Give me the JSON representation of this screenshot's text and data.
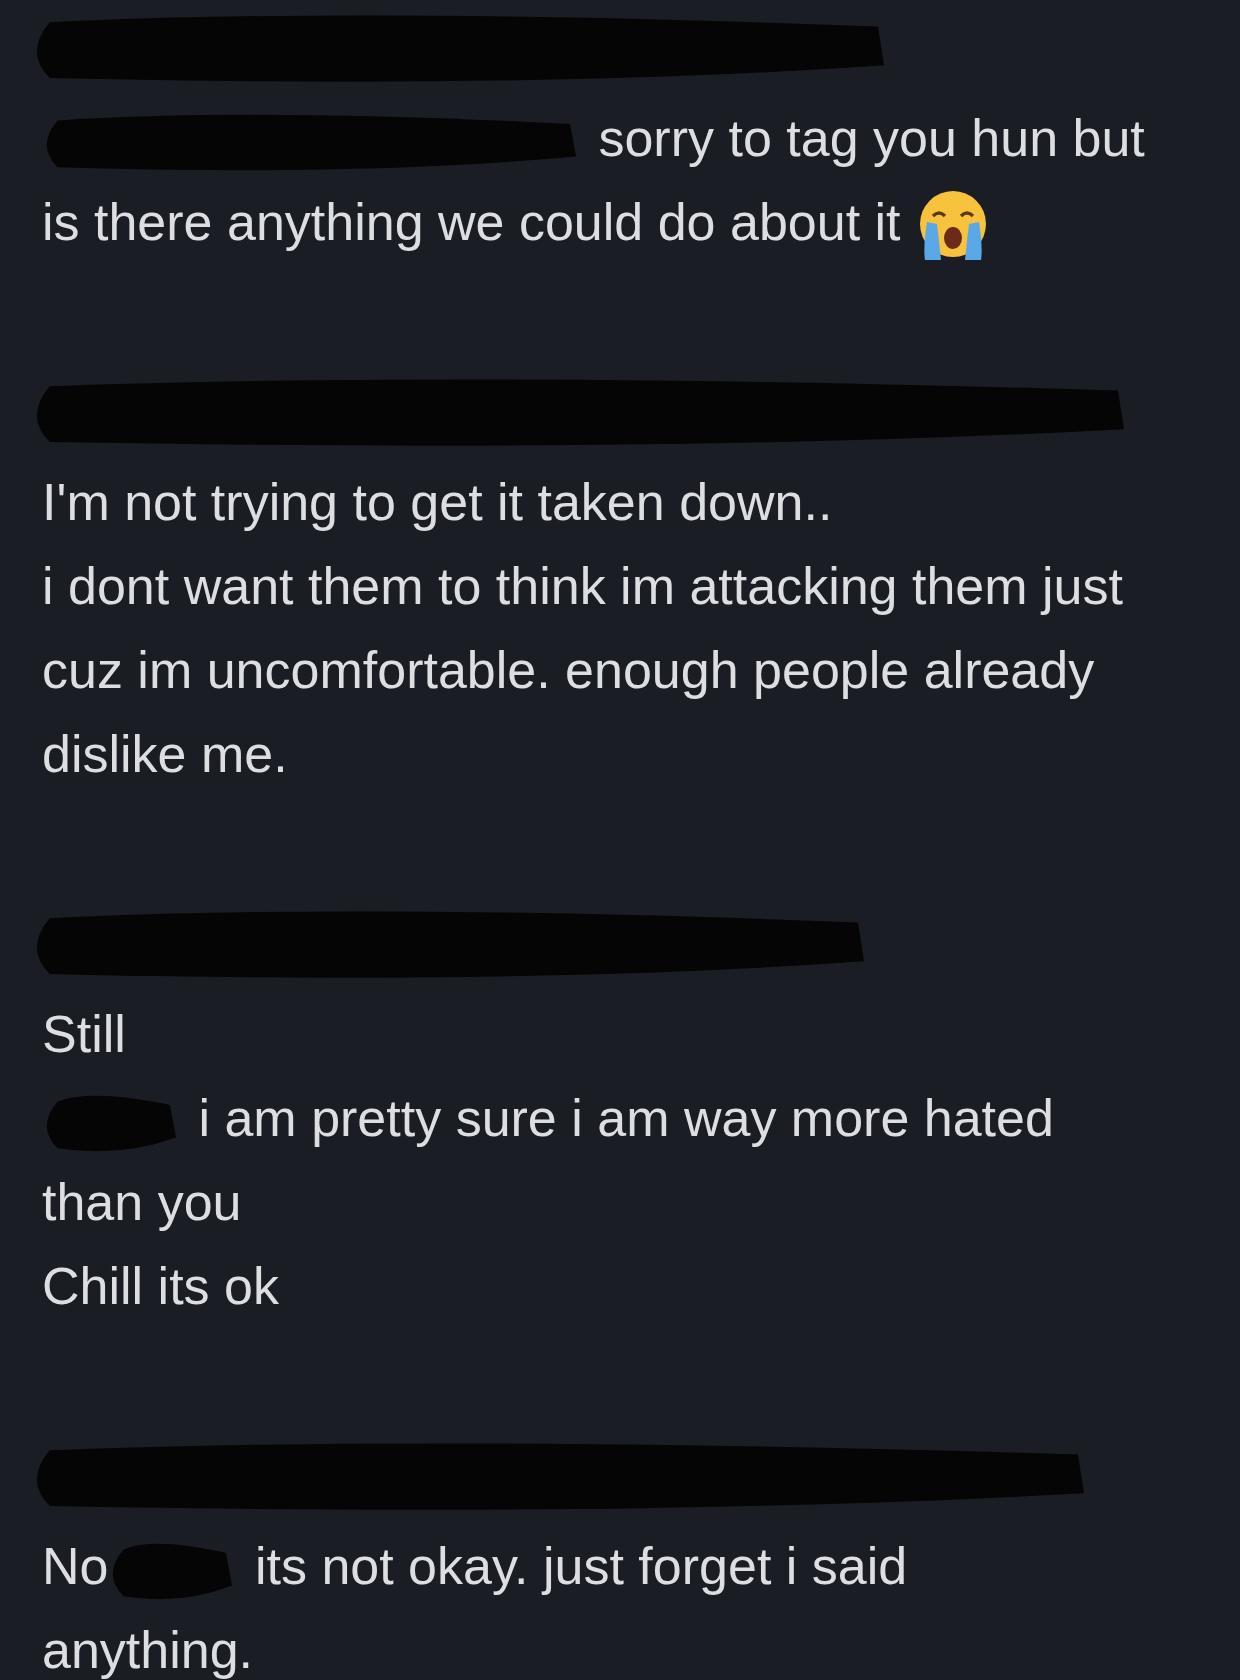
{
  "messages": [
    {
      "header_redacted": true,
      "lines": [
        {
          "segments": [
            {
              "kind": "redaction"
            },
            {
              "kind": "text",
              "text": "sorry to tag you hun but"
            }
          ]
        },
        {
          "segments": [
            {
              "kind": "text",
              "text": "is there anything we could do about it"
            },
            {
              "kind": "emoji"
            }
          ]
        }
      ]
    },
    {
      "header_redacted": true,
      "lines": [
        {
          "segments": [
            {
              "kind": "text",
              "text": "I'm not trying to get it taken down.."
            }
          ]
        },
        {
          "segments": [
            {
              "kind": "text",
              "text": "i dont want them to think im attacking them just cuz im uncomfortable. enough people already dislike me."
            }
          ]
        }
      ]
    },
    {
      "header_redacted": true,
      "lines": [
        {
          "segments": [
            {
              "kind": "text",
              "text": "Still"
            }
          ]
        },
        {
          "segments": [
            {
              "kind": "redaction"
            },
            {
              "kind": "text",
              "text": "i am pretty sure i am way more hated"
            }
          ]
        },
        {
          "segments": [
            {
              "kind": "text",
              "text": "than you"
            }
          ]
        },
        {
          "segments": [
            {
              "kind": "text",
              "text": "Chill its ok"
            }
          ]
        }
      ]
    },
    {
      "header_redacted": true,
      "lines": [
        {
          "segments": [
            {
              "kind": "text",
              "text": "No"
            },
            {
              "kind": "redaction"
            },
            {
              "kind": "text",
              "text": "its not okay. just forget i said"
            }
          ]
        },
        {
          "segments": [
            {
              "kind": "text",
              "text": "anything."
            }
          ]
        }
      ]
    }
  ]
}
